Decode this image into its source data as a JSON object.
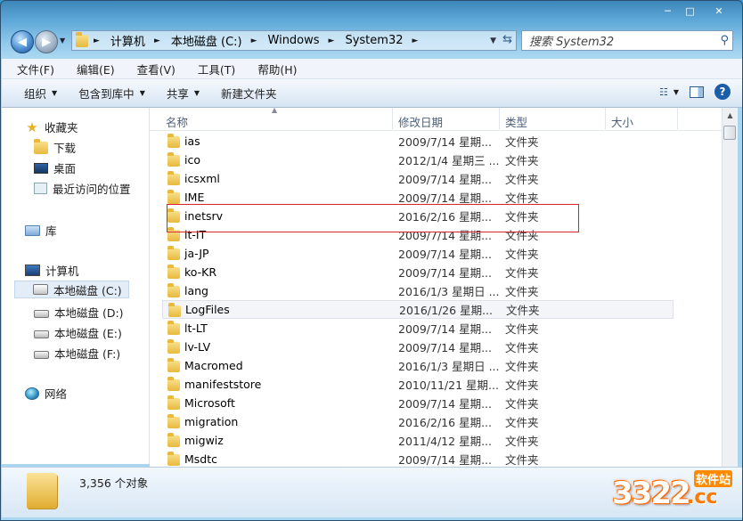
{
  "window": {
    "caption": {
      "minimize": "─",
      "maximize": "□",
      "close": "✕"
    }
  },
  "address": {
    "crumbs": [
      "计算机",
      "本地磁盘 (C:)",
      "Windows",
      "System32"
    ],
    "separator": "►",
    "dropdown": "▼",
    "refresh": "⇆"
  },
  "search": {
    "placeholder": "搜索 System32",
    "icon": "search-icon"
  },
  "menu": [
    "文件(F)",
    "编辑(E)",
    "查看(V)",
    "工具(T)",
    "帮助(H)"
  ],
  "toolbar": {
    "organize": "组织",
    "include_library": "包含到库中",
    "share": "共享",
    "new_folder": "新建文件夹",
    "help": "?"
  },
  "nav": {
    "favorites": "收藏夹",
    "downloads": "下载",
    "desktop": "桌面",
    "recent": "最近访问的位置",
    "libraries": "库",
    "computer": "计算机",
    "drive_c": "本地磁盘 (C:)",
    "drive_d": "本地磁盘 (D:)",
    "drive_e": "本地磁盘 (E:)",
    "drive_f": "本地磁盘 (F:)",
    "network": "网络"
  },
  "columns": {
    "name": "名称",
    "modified": "修改日期",
    "type": "类型",
    "size": "大小"
  },
  "files": [
    {
      "name": "ias",
      "date": "2009/7/14 星期...",
      "type": "文件夹"
    },
    {
      "name": "ico",
      "date": "2012/1/4 星期三 ...",
      "type": "文件夹"
    },
    {
      "name": "icsxml",
      "date": "2009/7/14 星期...",
      "type": "文件夹"
    },
    {
      "name": "IME",
      "date": "2009/7/14 星期...",
      "type": "文件夹"
    },
    {
      "name": "inetsrv",
      "date": "2016/2/16 星期...",
      "type": "文件夹"
    },
    {
      "name": "it-IT",
      "date": "2009/7/14 星期...",
      "type": "文件夹"
    },
    {
      "name": "ja-JP",
      "date": "2009/7/14 星期...",
      "type": "文件夹"
    },
    {
      "name": "ko-KR",
      "date": "2009/7/14 星期...",
      "type": "文件夹"
    },
    {
      "name": "lang",
      "date": "2016/1/3 星期日 ...",
      "type": "文件夹"
    },
    {
      "name": "LogFiles",
      "date": "2016/1/26 星期...",
      "type": "文件夹"
    },
    {
      "name": "lt-LT",
      "date": "2009/7/14 星期...",
      "type": "文件夹"
    },
    {
      "name": "lv-LV",
      "date": "2009/7/14 星期...",
      "type": "文件夹"
    },
    {
      "name": "Macromed",
      "date": "2016/1/3 星期日 ...",
      "type": "文件夹"
    },
    {
      "name": "manifeststore",
      "date": "2010/11/21 星期...",
      "type": "文件夹"
    },
    {
      "name": "Microsoft",
      "date": "2009/7/14 星期...",
      "type": "文件夹"
    },
    {
      "name": "migration",
      "date": "2016/2/16 星期...",
      "type": "文件夹"
    },
    {
      "name": "migwiz",
      "date": "2011/4/12 星期...",
      "type": "文件夹"
    },
    {
      "name": "Msdtc",
      "date": "2009/7/14 星期...",
      "type": "文件夹"
    }
  ],
  "status": {
    "count": "3,356 个对象"
  },
  "watermark": {
    "number": "3322",
    "suffix": ".cc",
    "site": "软件站"
  },
  "colors": {
    "highlight_box": "#d9232d",
    "accent": "#1c5da8"
  }
}
